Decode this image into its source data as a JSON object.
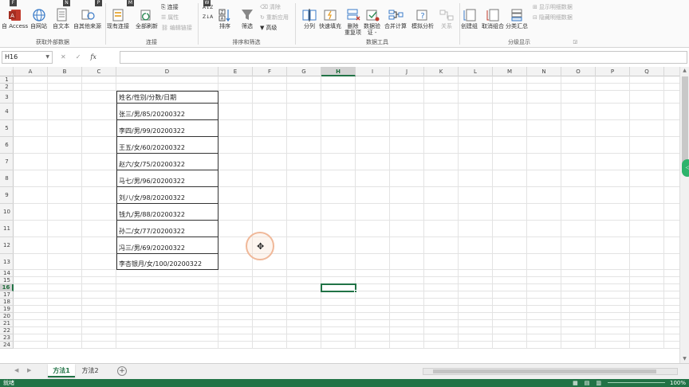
{
  "ribbon": {
    "keytips": [
      {
        "id": "ktF",
        "label": "F"
      },
      {
        "id": "ktN",
        "label": "N"
      },
      {
        "id": "ktP",
        "label": "P"
      },
      {
        "id": "ktM",
        "label": "M"
      },
      {
        "id": "ktW",
        "label": "W"
      }
    ],
    "groups": {
      "external": {
        "label": "获取外部数据",
        "buttons": [
          "自 Access",
          "自网站",
          "自文本",
          "自其他来源"
        ]
      },
      "connections": {
        "label": "连接",
        "buttons": {
          "existing": "现有连接",
          "refresh_all": "全部刷新",
          "connections": "连接",
          "properties": "属性",
          "edit_links": "编辑链接"
        }
      },
      "sort_filter": {
        "label": "排序和筛选",
        "buttons": {
          "sort": "排序",
          "filter": "筛选",
          "clear": "清除",
          "reapply": "重新应用",
          "advanced": "高级",
          "az": "A↓Z",
          "za": "Z↓A"
        }
      },
      "data_tools": {
        "label": "数据工具",
        "buttons": {
          "split": "分列",
          "flash_fill": "快速填充",
          "remove_dup_1": "删除",
          "remove_dup_2": "重复项",
          "validation_1": "数据验",
          "validation_2": "证 -",
          "consolidate": "合并计算",
          "what_if": "模拟分析",
          "relationships": "关系"
        }
      },
      "outline": {
        "label": "分级显示",
        "buttons": {
          "group": "创建组",
          "ungroup": "取消组合",
          "subtotal": "分类汇总",
          "show_detail": "显示明细数据",
          "hide_detail": "隐藏明细数据"
        }
      }
    }
  },
  "formula_bar": {
    "name_box": "H16",
    "cancel": "✕",
    "enter": "✓",
    "fx": "fx",
    "formula": ""
  },
  "grid": {
    "columns": [
      "A",
      "B",
      "C",
      "D",
      "E",
      "F",
      "G",
      "H",
      "I",
      "J",
      "K",
      "L",
      "M",
      "N",
      "O",
      "P",
      "Q"
    ],
    "selected_column": "H",
    "rows": [
      "1",
      "2",
      "3",
      "4",
      "5",
      "6",
      "7",
      "8",
      "9",
      "10",
      "11",
      "12",
      "13",
      "14",
      "15",
      "16",
      "17",
      "18",
      "19",
      "20",
      "21",
      "22",
      "23",
      "24"
    ],
    "selected_row": "16",
    "column_d_values": [
      "姓名/性别/分数/日期",
      "张三/男/85/20200322",
      "李四/男/99/20200322",
      "王五/女/60/20200322",
      "赵六/女/75/20200322",
      "马七/男/96/20200322",
      "刘八/女/98/20200322",
      "钱九/男/88/20200322",
      "孙二/女/77/20200322",
      "冯三/男/69/20200322",
      "李杏银月/女/100/20200322"
    ]
  },
  "sheets": {
    "tabs": [
      "方法1",
      "方法2"
    ],
    "active": "方法1",
    "add_label": "+"
  },
  "status": {
    "ready": "就绪",
    "zoom": "100%"
  },
  "colors": {
    "accent": "#217346",
    "cursor_ring": "#f0b899",
    "side_tab": "#2db36b"
  }
}
